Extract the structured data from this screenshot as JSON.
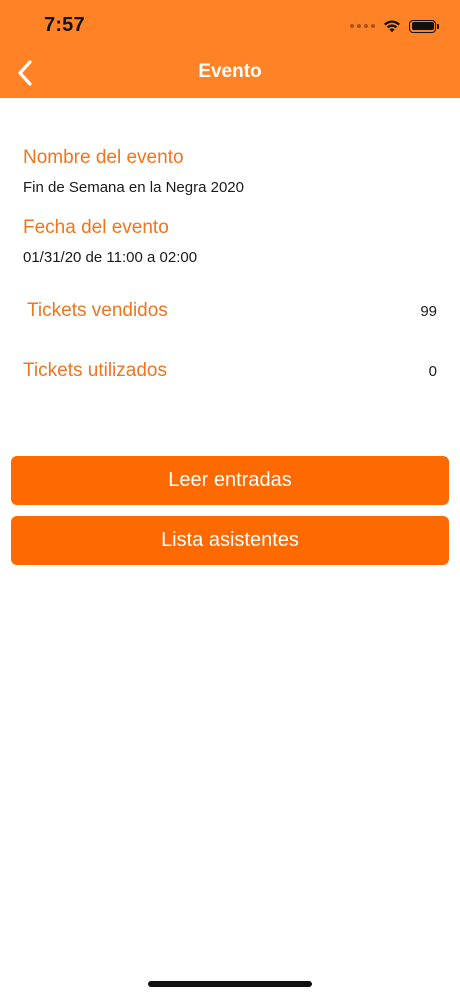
{
  "status_bar": {
    "time": "7:57"
  },
  "nav": {
    "title": "Evento",
    "back_icon": "chevron-left-icon"
  },
  "event": {
    "name_label": "Nombre del evento",
    "name_value": "Fin de Semana en la Negra 2020",
    "date_label": "Fecha del evento",
    "date_value": "01/31/20 de 11:00 a 02:00",
    "sold_label": "Tickets vendidos",
    "sold_value": "99",
    "used_label": "Tickets utilizados",
    "used_value": "0"
  },
  "actions": {
    "read_tickets": "Leer entradas",
    "attendee_list": "Lista asistentes"
  },
  "colors": {
    "header_bg": "#FF8326",
    "label": "#F2741C",
    "button_bg": "#FF6A00"
  }
}
